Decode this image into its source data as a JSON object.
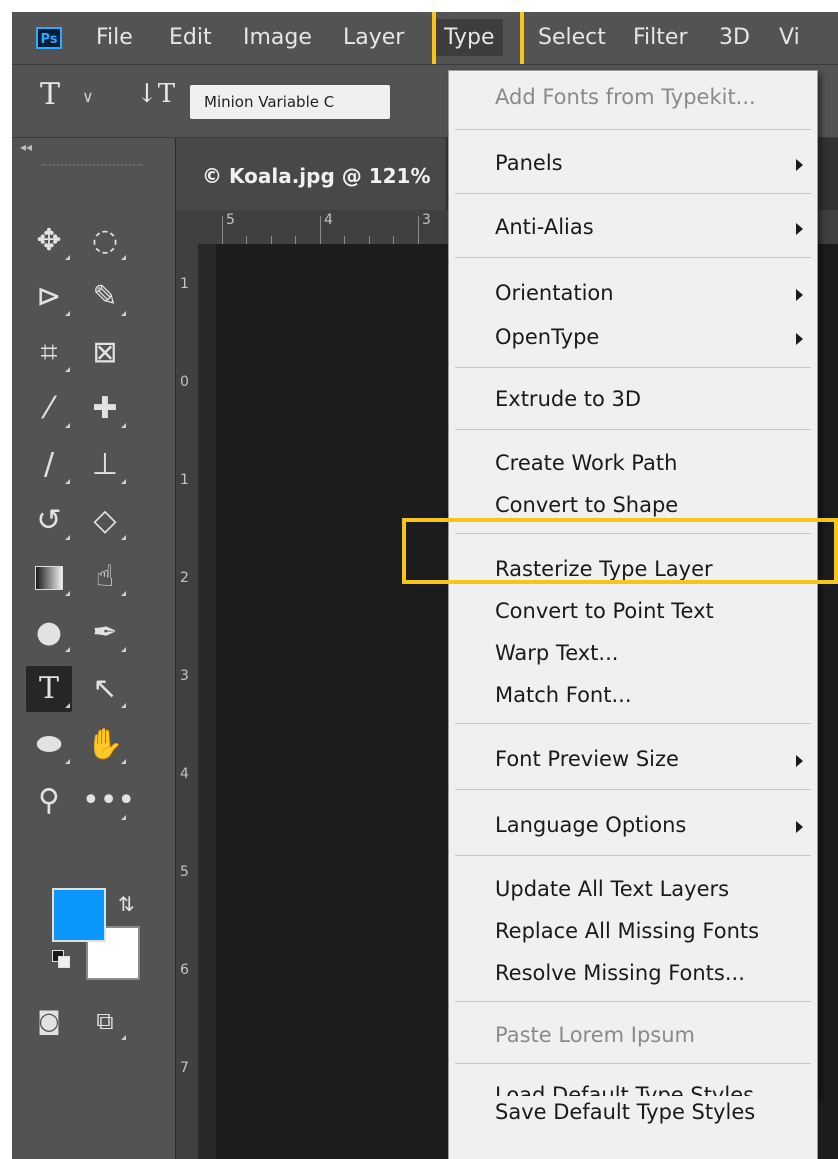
{
  "menubar": {
    "logo": "Ps",
    "items": [
      "File",
      "Edit",
      "Image",
      "Layer",
      "Type",
      "Select",
      "Filter",
      "3D",
      "Vi"
    ]
  },
  "options_bar": {
    "tool_icon": "type-tool-icon",
    "font_family": "Minion Variable C"
  },
  "document": {
    "tab_title": "© Koala.jpg @ 121%"
  },
  "rulers": {
    "horizontal": [
      "5",
      "4",
      "3"
    ],
    "vertical": [
      "1",
      "0",
      "1",
      "2",
      "3",
      "4",
      "5",
      "6",
      "7"
    ]
  },
  "toolbar": {
    "collapse": "◂◂",
    "tools": [
      "move-icon",
      "ellipse-marquee-icon",
      "polygonal-lasso-icon",
      "quick-selection-icon",
      "crop-icon",
      "frame-icon",
      "eyedropper-icon",
      "healing-brush-icon",
      "brush-icon",
      "clone-stamp-icon",
      "history-brush-icon",
      "eraser-icon",
      "gradient-icon",
      "smudge-icon",
      "dodge-icon",
      "pen-icon",
      "type-icon",
      "path-selection-icon",
      "ellipse-shape-icon",
      "hand-icon",
      "zoom-icon",
      "more-tools-icon",
      "quick-mask-icon",
      "screen-mode-icon"
    ],
    "foreground_color": "#0a96fa",
    "background_color": "#ffffff"
  },
  "type_menu": {
    "items": [
      {
        "label": "Add Fonts from Typekit...",
        "disabled": true
      },
      {
        "label": "Panels",
        "submenu": true
      },
      {
        "label": "Anti-Alias",
        "submenu": true
      },
      {
        "label": "Orientation",
        "submenu": true
      },
      {
        "label": "OpenType",
        "submenu": true
      },
      {
        "label": "Extrude to 3D"
      },
      {
        "label": "Create Work Path"
      },
      {
        "label": "Convert to Shape"
      },
      {
        "label": "Rasterize Type Layer",
        "highlighted": true
      },
      {
        "label": "Convert to Point Text"
      },
      {
        "label": "Warp Text..."
      },
      {
        "label": "Match Font..."
      },
      {
        "label": "Font Preview Size",
        "submenu": true
      },
      {
        "label": "Language Options",
        "submenu": true
      },
      {
        "label": "Update All Text Layers"
      },
      {
        "label": "Replace All Missing Fonts"
      },
      {
        "label": "Resolve Missing Fonts..."
      },
      {
        "label": "Paste Lorem Ipsum",
        "disabled": true
      },
      {
        "label": "Load Default Type Styles"
      },
      {
        "label": "Save Default Type Styles"
      }
    ]
  },
  "highlight_color": "#f5c518"
}
